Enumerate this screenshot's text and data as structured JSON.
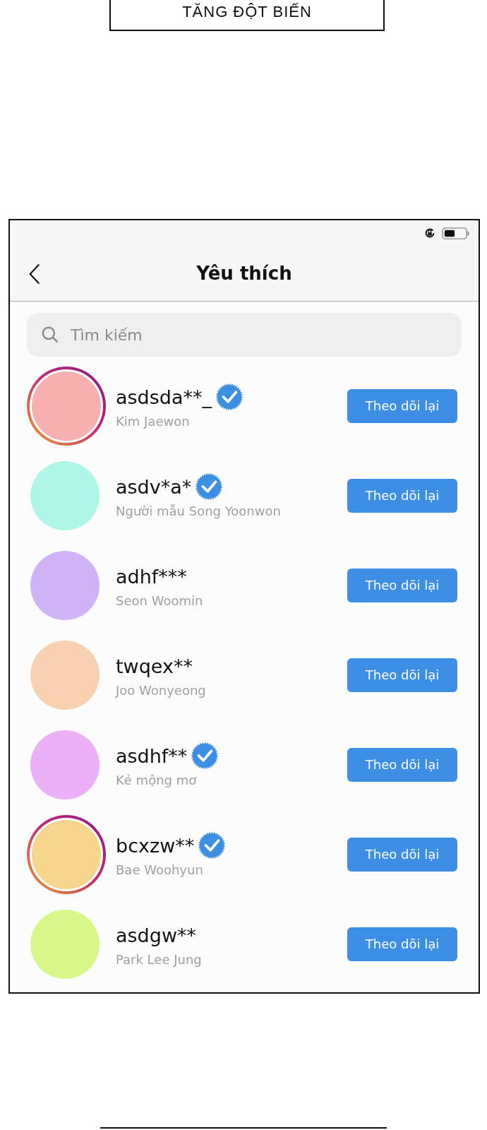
{
  "caption": {
    "text": "TĂNG ĐỘT BIẾN"
  },
  "screen": {
    "title": "Yêu thích",
    "search": {
      "placeholder": "Tìm kiếm"
    },
    "users": [
      {
        "username": "asdsda**_",
        "name": "Kim Jaewon",
        "verified": true,
        "story": true,
        "color": "#f8b0b0",
        "button": "Theo dõi lại"
      },
      {
        "username": "asdv*a*",
        "name": "Người mẫu Song Yoonwon",
        "verified": true,
        "story": false,
        "color": "#b0f6e8",
        "button": "Theo dõi lại"
      },
      {
        "username": "adhf***",
        "name": "Seon Woomin",
        "verified": false,
        "story": false,
        "color": "#d0b4f6",
        "button": "Theo dõi lại"
      },
      {
        "username": "twqex**",
        "name": "Joo Wonyeong",
        "verified": false,
        "story": false,
        "color": "#f8d2b0",
        "button": "Theo dõi lại"
      },
      {
        "username": "asdhf**",
        "name": "Kẻ mộng mơ",
        "verified": true,
        "story": false,
        "color": "#ecb0f6",
        "button": "Theo dõi lại"
      },
      {
        "username": "bcxzw**",
        "name": "Bae Woohyun",
        "verified": true,
        "story": true,
        "color": "#f6d68c",
        "button": "Theo dõi lại"
      },
      {
        "username": "asdgw**",
        "name": "Park Lee Jung",
        "verified": false,
        "story": false,
        "color": "#d8f88a",
        "button": "Theo dõi lại"
      }
    ]
  }
}
